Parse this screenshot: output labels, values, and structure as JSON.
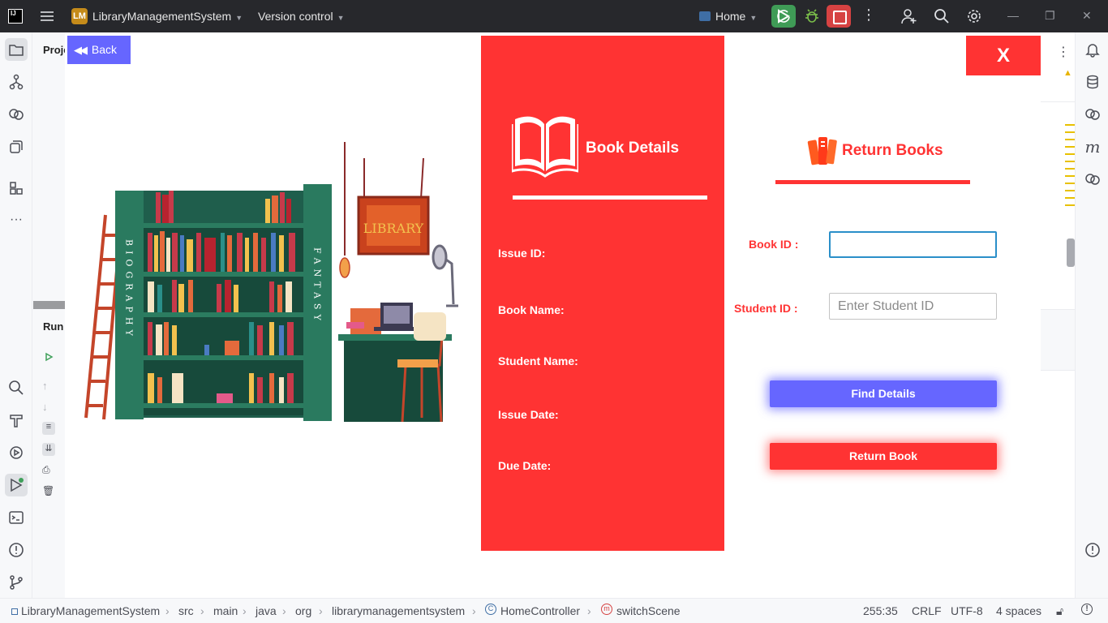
{
  "ide": {
    "project_badge": "LM",
    "project_name": "LibraryManagementSystem",
    "version_control": "Version control",
    "run_config": "Home",
    "project_panel_title": "Proje",
    "run_panel_title": "Run"
  },
  "app": {
    "back_label": "Back",
    "close_label": "X",
    "details": {
      "title": "Book Details",
      "fields": {
        "issue_id": "Issue ID:",
        "book_name": "Book Name:",
        "student_name": "Student Name:",
        "issue_date": "Issue Date:",
        "due_date": "Due Date:"
      }
    },
    "return_title": "Return Books",
    "book_id_label": "Book ID :",
    "book_id_value": "",
    "student_id_label": "Student ID :",
    "student_id_placeholder": "Enter Student ID",
    "find_button": "Find Details",
    "return_button": "Return Book",
    "illustration": {
      "sign_text": "LIBRARY",
      "left_spine": "BIOGRAPHY",
      "right_spine": "FANTASY"
    }
  },
  "statusbar": {
    "crumbs": [
      "LibraryManagementSystem",
      "src",
      "main",
      "java",
      "org",
      "librarymanagementsystem",
      "HomeController",
      "switchScene"
    ],
    "position": "255:35",
    "line_sep": "CRLF",
    "encoding": "UTF-8",
    "indent": "4 spaces"
  },
  "colors": {
    "accent_red": "#ff3333",
    "accent_blue": "#6666ff",
    "titlebar": "#27282c"
  }
}
